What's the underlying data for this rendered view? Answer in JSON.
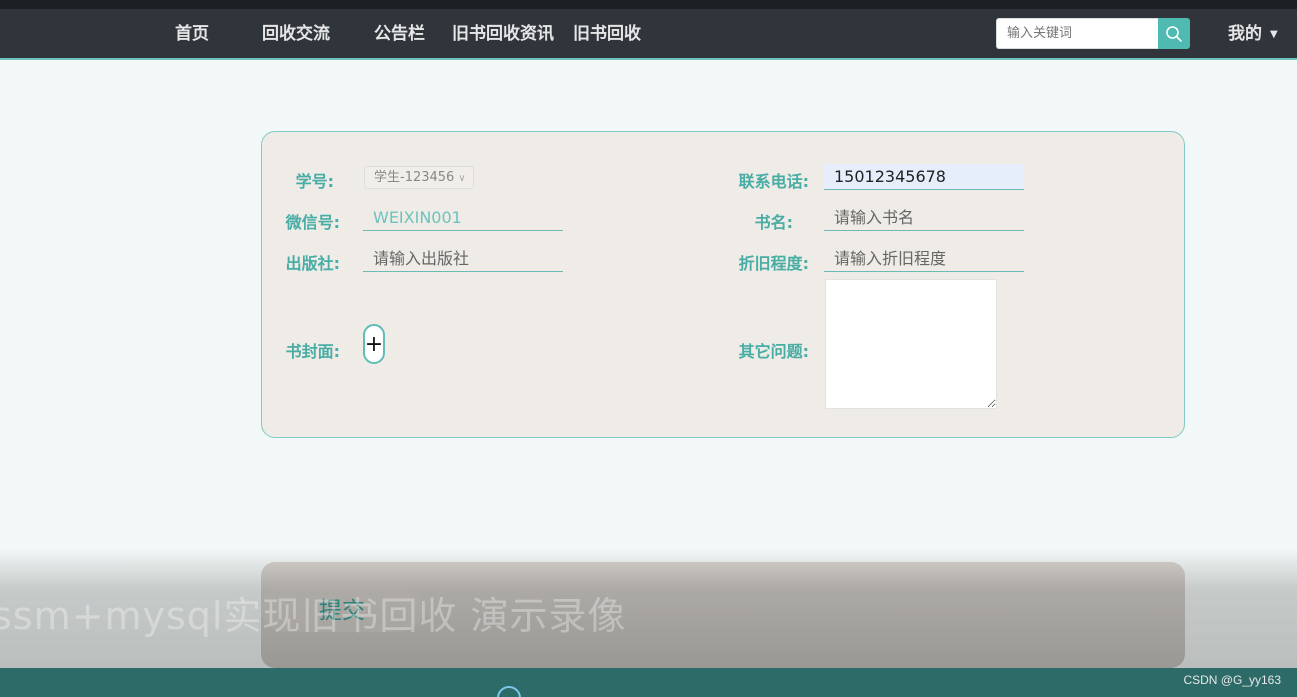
{
  "nav": {
    "items": [
      {
        "label": "首页"
      },
      {
        "label": "回收交流"
      },
      {
        "label": "公告栏"
      },
      {
        "label": "旧书回收资讯"
      },
      {
        "label": "旧书回收"
      }
    ],
    "search_placeholder": "输入关键词",
    "mine_label": "我的"
  },
  "form": {
    "student_id_label": "学号:",
    "student_id_value": "学生-123456",
    "phone_label": "联系电话:",
    "phone_value": "15012345678",
    "wechat_label": "微信号:",
    "wechat_value": "WEIXIN001",
    "book_name_label": "书名:",
    "book_name_placeholder": "请输入书名",
    "publisher_label": "出版社:",
    "publisher_placeholder": "请输入出版社",
    "condition_label": "折旧程度:",
    "condition_placeholder": "请输入折旧程度",
    "cover_label": "书封面:",
    "cover_upload_glyph": "+",
    "other_label": "其它问题:"
  },
  "submit_label": "提交",
  "overlay_caption": "ssm+mysql实现旧书回收  演示录像",
  "footer_credit": "CSDN @G_yy163",
  "colors": {
    "accent": "#4fbab1",
    "navbar": "#2f353b",
    "label": "#47ada5",
    "card": "#efebe6"
  }
}
